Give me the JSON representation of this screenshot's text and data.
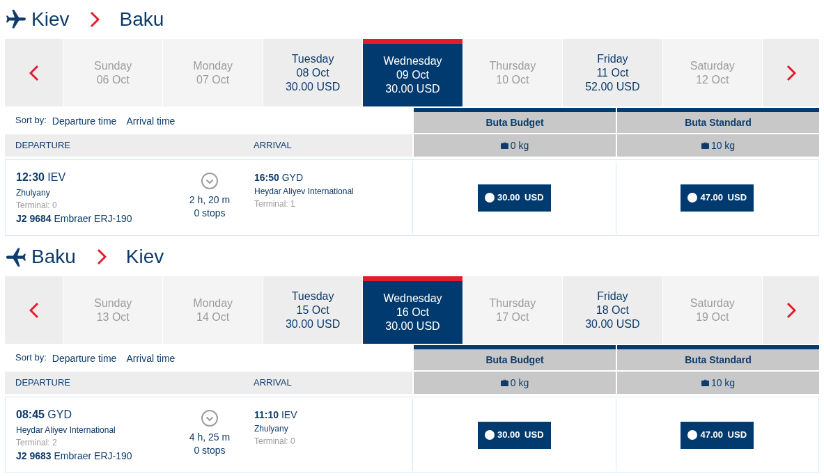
{
  "itineraries": [
    {
      "kind": "outbound",
      "origin": "Kiev",
      "destination": "Baku",
      "dates": [
        {
          "day": "Sunday",
          "date": "06 Oct",
          "selected": false,
          "disabled": true
        },
        {
          "day": "Monday",
          "date": "07 Oct",
          "selected": false,
          "disabled": true
        },
        {
          "day": "Tuesday",
          "date": "08 Oct",
          "price": "30.00 USD",
          "selected": false,
          "disabled": false
        },
        {
          "day": "Wednesday",
          "date": "09 Oct",
          "price": "30.00 USD",
          "selected": true,
          "disabled": false
        },
        {
          "day": "Thursday",
          "date": "10 Oct",
          "selected": false,
          "disabled": true
        },
        {
          "day": "Friday",
          "date": "11 Oct",
          "price": "52.00 USD",
          "selected": false,
          "disabled": false
        },
        {
          "day": "Saturday",
          "date": "12 Oct",
          "selected": false,
          "disabled": true
        }
      ],
      "sort": {
        "label": "Sort by:",
        "options": [
          "Departure time",
          "Arrival time"
        ]
      },
      "columns": {
        "departure": "DEPARTURE",
        "arrival": "ARRIVAL"
      },
      "fares": [
        {
          "name": "Buta Budget",
          "baggage": "0 kg"
        },
        {
          "name": "Buta Standard",
          "baggage": "10 kg"
        }
      ],
      "flights": [
        {
          "departure": {
            "time": "**12:30** IEV",
            "airport": "Zhulyany",
            "terminal": "Terminal: 0"
          },
          "flight": "**J2 9684** Embraer ERJ-190",
          "duration": "2 h, 20 m",
          "stops": "0 stops",
          "arrival": {
            "time": "**16:50** GYD",
            "airport": "Heydar Aliyev International",
            "terminal": "Terminal: 1"
          },
          "prices": [
            "30.00 USD",
            "47.00 USD"
          ]
        }
      ]
    },
    {
      "kind": "return",
      "origin": "Baku",
      "destination": "Kiev",
      "dates": [
        {
          "day": "Sunday",
          "date": "13 Oct",
          "selected": false,
          "disabled": true
        },
        {
          "day": "Monday",
          "date": "14 Oct",
          "selected": false,
          "disabled": true
        },
        {
          "day": "Tuesday",
          "date": "15 Oct",
          "price": "30.00 USD",
          "selected": false,
          "disabled": false
        },
        {
          "day": "Wednesday",
          "date": "16 Oct",
          "price": "30.00 USD",
          "selected": true,
          "disabled": false
        },
        {
          "day": "Thursday",
          "date": "17 Oct",
          "selected": false,
          "disabled": true
        },
        {
          "day": "Friday",
          "date": "18 Oct",
          "price": "30.00 USD",
          "selected": false,
          "disabled": false
        },
        {
          "day": "Saturday",
          "date": "19 Oct",
          "selected": false,
          "disabled": true
        }
      ],
      "sort": {
        "label": "Sort by:",
        "options": [
          "Departure time",
          "Arrival time"
        ]
      },
      "columns": {
        "departure": "DEPARTURE",
        "arrival": "ARRIVAL"
      },
      "fares": [
        {
          "name": "Buta Budget",
          "baggage": "0 kg"
        },
        {
          "name": "Buta Standard",
          "baggage": "10 kg"
        }
      ],
      "flights": [
        {
          "departure": {
            "time": "**08:45** GYD",
            "airport": "Heydar Aliyev International",
            "terminal": "Terminal: 2"
          },
          "flight": "**J2 9683** Embraer ERJ-190",
          "duration": "4 h, 25 m",
          "stops": "0 stops",
          "arrival": {
            "time": "**11:10** IEV",
            "airport": "Zhulyany",
            "terminal": "Terminal: 0"
          },
          "prices": [
            "30.00 USD",
            "47.00 USD"
          ]
        }
      ]
    }
  ]
}
